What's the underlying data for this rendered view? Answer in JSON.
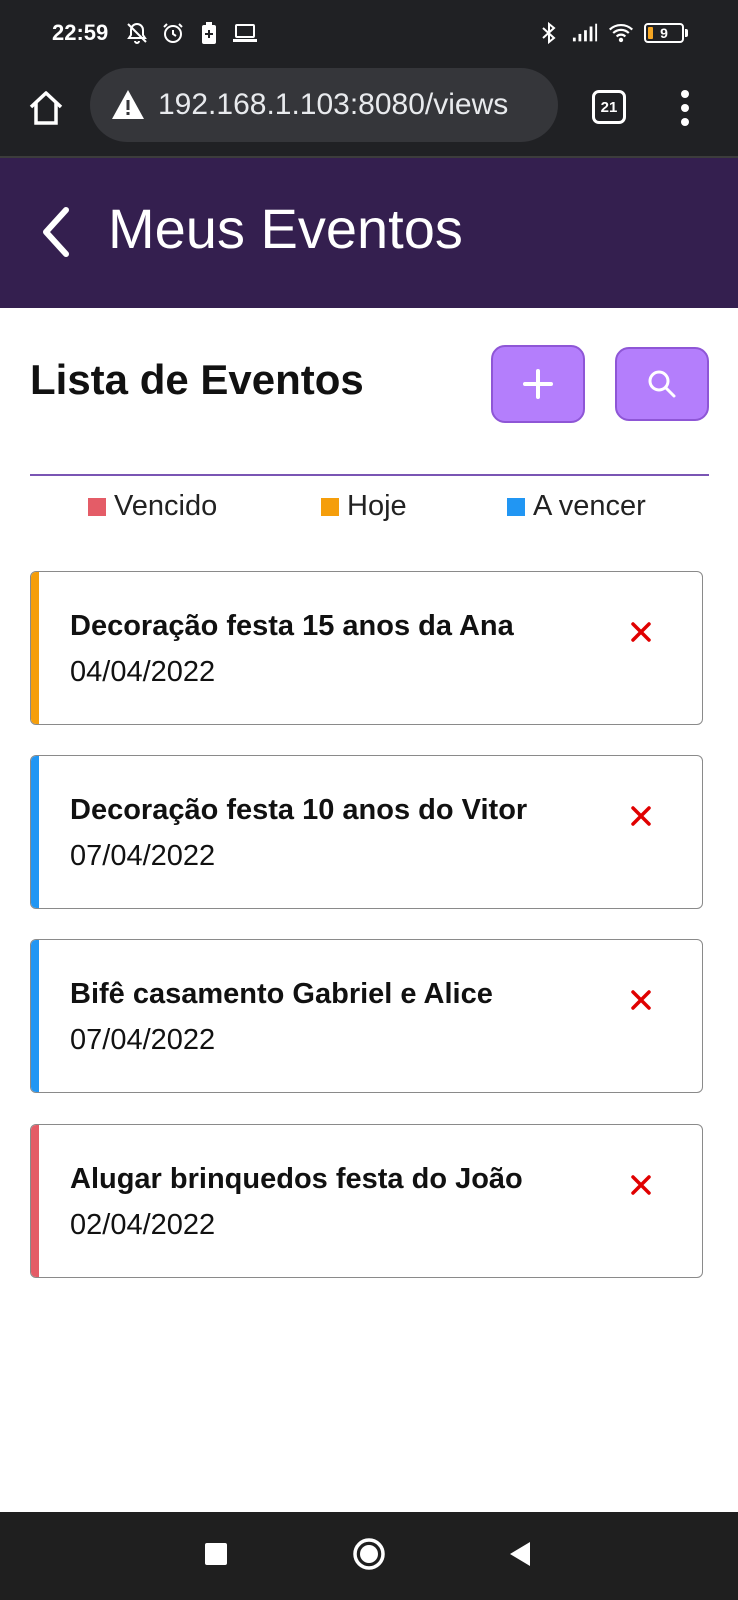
{
  "status_bar": {
    "time": "22:59",
    "battery_level": "9",
    "icons_left": [
      "bell-off-icon",
      "alarm-icon",
      "battery-saver-icon",
      "laptop-icon"
    ],
    "icons_right": [
      "bluetooth-icon",
      "signal-icon",
      "wifi-icon",
      "battery-icon"
    ]
  },
  "browser": {
    "url": "192.168.1.103:8080/views",
    "tab_count": "21"
  },
  "header": {
    "title": "Meus Eventos"
  },
  "main": {
    "list_title": "Lista de Eventos"
  },
  "legend": [
    {
      "label": "Vencido",
      "color": "#e45c67"
    },
    {
      "label": "Hoje",
      "color": "#f59e0b"
    },
    {
      "label": "A vencer",
      "color": "#2196f3"
    }
  ],
  "events": [
    {
      "title": "Decoração festa 15 anos da Ana",
      "date": "04/04/2022",
      "status": "Hoje",
      "color": "#f59e0b"
    },
    {
      "title": "Decoração festa 10 anos do Vitor",
      "date": "07/04/2022",
      "status": "A vencer",
      "color": "#2196f3"
    },
    {
      "title": "Bifê casamento Gabriel e Alice",
      "date": "07/04/2022",
      "status": "A vencer",
      "color": "#2196f3"
    },
    {
      "title": "Alugar brinquedos festa do João",
      "date": "02/04/2022",
      "status": "Vencido",
      "color": "#e45c67"
    }
  ],
  "colors": {
    "header_bg": "#341f4f",
    "button_bg": "#b47efc",
    "divider": "#7a55b4",
    "delete_icon": "#e00000"
  }
}
